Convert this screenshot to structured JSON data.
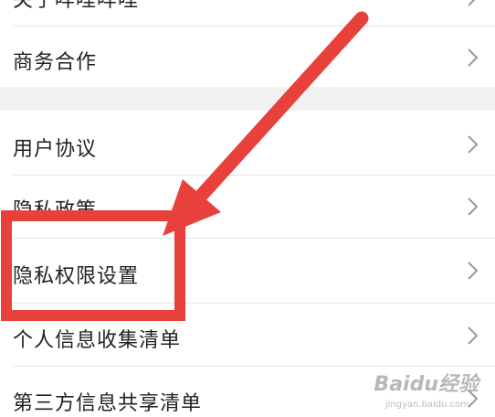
{
  "menu": {
    "group1": [
      {
        "label": "关于咩哩咩哩"
      },
      {
        "label": "商务合作"
      }
    ],
    "group2": [
      {
        "label": "用户协议"
      },
      {
        "label": "隐私政策"
      },
      {
        "label": "隐私权限设置"
      },
      {
        "label": "个人信息收集清单"
      },
      {
        "label": "第三方信息共享清单"
      }
    ]
  },
  "annotation": {
    "color": "#e8403a",
    "target": "隐私权限设置"
  },
  "watermark": {
    "brand": "Baidu经验",
    "url": "jingyan.baidu.com"
  },
  "icons": {
    "row_chevron": "chevron-right-icon"
  }
}
